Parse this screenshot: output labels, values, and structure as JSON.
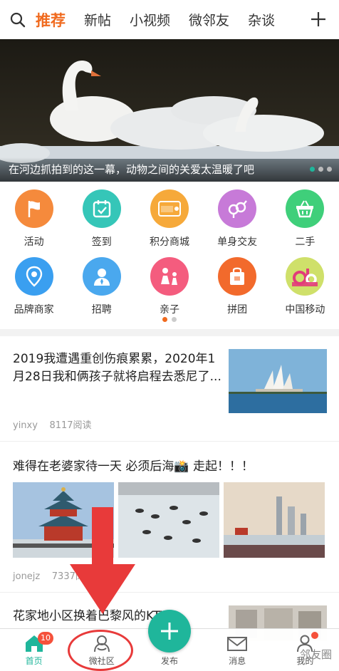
{
  "nav": {
    "tabs": [
      "推荐",
      "新帖",
      "小视频",
      "微邻友",
      "杂谈"
    ],
    "active_tab": "推荐",
    "accent_color": "#f06a1e"
  },
  "banner": {
    "caption": "在河边抓拍到的这一幕，动物之间的关爱太温暖了吧",
    "slide_count": 3,
    "active_slide": 1
  },
  "grid": {
    "row1": [
      {
        "label": "活动",
        "icon": "flag-icon",
        "color": "#f58a3c"
      },
      {
        "label": "签到",
        "icon": "calendar-check-icon",
        "color": "#35c6b8"
      },
      {
        "label": "积分商城",
        "icon": "points-card-icon",
        "color": "#f6a93a"
      },
      {
        "label": "单身交友",
        "icon": "gender-symbol-icon",
        "color": "#c77ad8"
      },
      {
        "label": "二手",
        "icon": "basket-icon",
        "color": "#3fcf7a"
      }
    ],
    "row2": [
      {
        "label": "品牌商家",
        "icon": "location-pin-icon",
        "color": "#3a9ff0"
      },
      {
        "label": "招聘",
        "icon": "person-tie-icon",
        "color": "#4aa8ee"
      },
      {
        "label": "亲子",
        "icon": "family-icon",
        "color": "#f45c7e"
      },
      {
        "label": "拼团",
        "icon": "shopping-bag-icon",
        "color": "#f26a2c"
      },
      {
        "label": "中国移动",
        "icon": "china-mobile-logo-icon",
        "color": "#cfe06a"
      }
    ],
    "pages": 2,
    "active_page": 1
  },
  "feed": {
    "post1": {
      "title": "2019我遭遇重创伤痕累累，2020年1月28日我和俩孩子就将启程去悉尼了...",
      "author": "yinxy",
      "reads": "8117阅读"
    },
    "post2": {
      "title": "难得在老婆家待一天  必须后海📸  走起！！！",
      "author": "jonejz",
      "reads": "7337阅读"
    },
    "post3": {
      "title": "花家地小区换着巴黎风的KTV"
    }
  },
  "bottombar": {
    "items": [
      "首页",
      "微社区",
      "发布",
      "消息",
      "我的"
    ],
    "home_badge": "10",
    "accent_color": "#1fb69b"
  },
  "watermark": "邻友圈"
}
